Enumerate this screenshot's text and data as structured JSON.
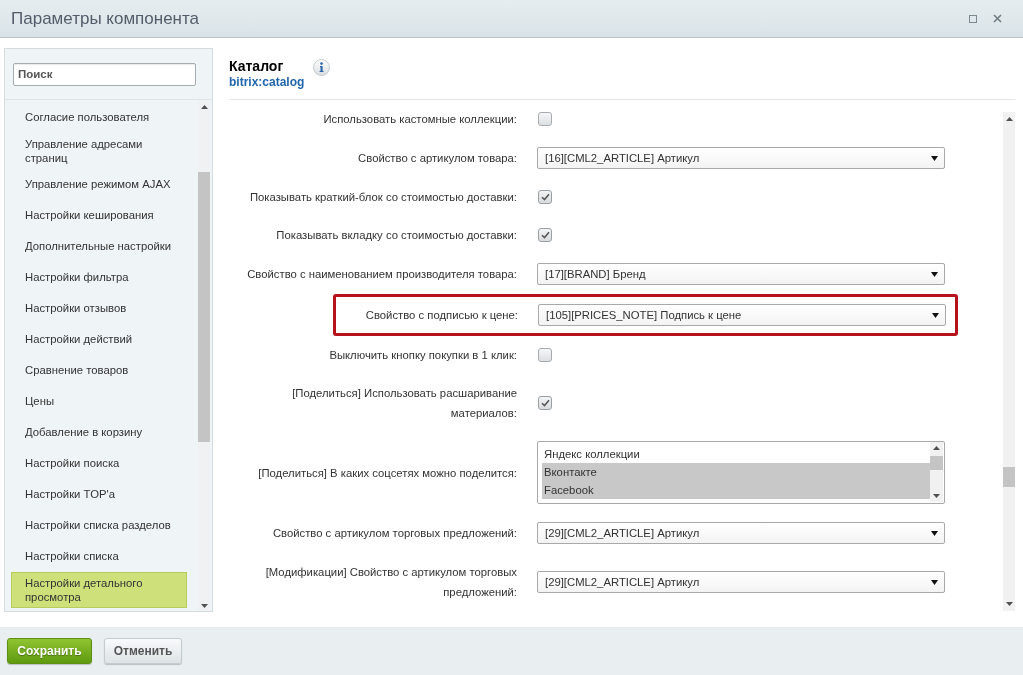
{
  "window": {
    "title": "Параметры компонента"
  },
  "sidebar": {
    "search": {
      "placeholder": "Поиск"
    },
    "items": [
      {
        "label": "Согласие пользователя",
        "selected": false
      },
      {
        "label": "Управление адресами страниц",
        "selected": false
      },
      {
        "label": "Управление режимом AJAX",
        "selected": false
      },
      {
        "label": "Настройки кеширования",
        "selected": false
      },
      {
        "label": "Дополнительные настройки",
        "selected": false
      },
      {
        "label": "Настройки фильтра",
        "selected": false
      },
      {
        "label": "Настройки отзывов",
        "selected": false
      },
      {
        "label": "Настройки действий",
        "selected": false
      },
      {
        "label": "Сравнение товаров",
        "selected": false
      },
      {
        "label": "Цены",
        "selected": false
      },
      {
        "label": "Добавление в корзину",
        "selected": false
      },
      {
        "label": "Настройки поиска",
        "selected": false
      },
      {
        "label": "Настройки TOP'а",
        "selected": false
      },
      {
        "label": "Настройки списка разделов",
        "selected": false
      },
      {
        "label": "Настройки списка",
        "selected": false
      },
      {
        "label": "Настройки детального просмотра",
        "selected": true
      }
    ]
  },
  "component": {
    "title": "Каталог",
    "code": "bitrix:catalog"
  },
  "form": {
    "rows": [
      {
        "kind": "checkbox",
        "label": "Использовать кастомные коллекции:",
        "checked": false,
        "highlighted": false
      },
      {
        "kind": "select",
        "label": "Свойство с артикулом товара:",
        "value": "[16][CML2_ARTICLE] Артикул",
        "highlighted": false
      },
      {
        "kind": "checkbox",
        "label": "Показывать краткий-блок со стоимостью доставки:",
        "checked": true,
        "highlighted": false
      },
      {
        "kind": "checkbox",
        "label": "Показывать вкладку со стоимостью доставки:",
        "checked": true,
        "highlighted": false
      },
      {
        "kind": "select",
        "label": "Свойство с наименованием производителя товара:",
        "value": "[17][BRAND] Бренд",
        "highlighted": false
      },
      {
        "kind": "select",
        "label": "Свойство с подписью к цене:",
        "value": "[105][PRICES_NOTE] Подпись к цене",
        "highlighted": true
      },
      {
        "kind": "checkbox",
        "label": "Выключить кнопку покупки в 1 клик:",
        "checked": false,
        "highlighted": false
      },
      {
        "kind": "checkbox",
        "label": "[Поделиться] Использовать расшаривание материалов:",
        "checked": true,
        "highlighted": false
      },
      {
        "kind": "listbox",
        "label": "[Поделиться] В каких соцсетях можно поделится:",
        "options": [
          {
            "label": "Яндекс коллекции",
            "selected": false
          },
          {
            "label": "Вконтакте",
            "selected": true
          },
          {
            "label": "Facebook",
            "selected": true
          }
        ],
        "highlighted": false
      },
      {
        "kind": "select",
        "label": "Свойство с артикулом торговых предложений:",
        "value": "[29][CML2_ARTICLE] Артикул",
        "highlighted": false
      },
      {
        "kind": "select",
        "label": "[Модификации] Свойство с артикулом торговых предложений:",
        "value": "[29][CML2_ARTICLE] Артикул",
        "highlighted": false
      }
    ]
  },
  "buttons": [
    {
      "label": "Сохранить",
      "kind": "primary"
    },
    {
      "label": "Отменить",
      "kind": "secondary"
    }
  ]
}
